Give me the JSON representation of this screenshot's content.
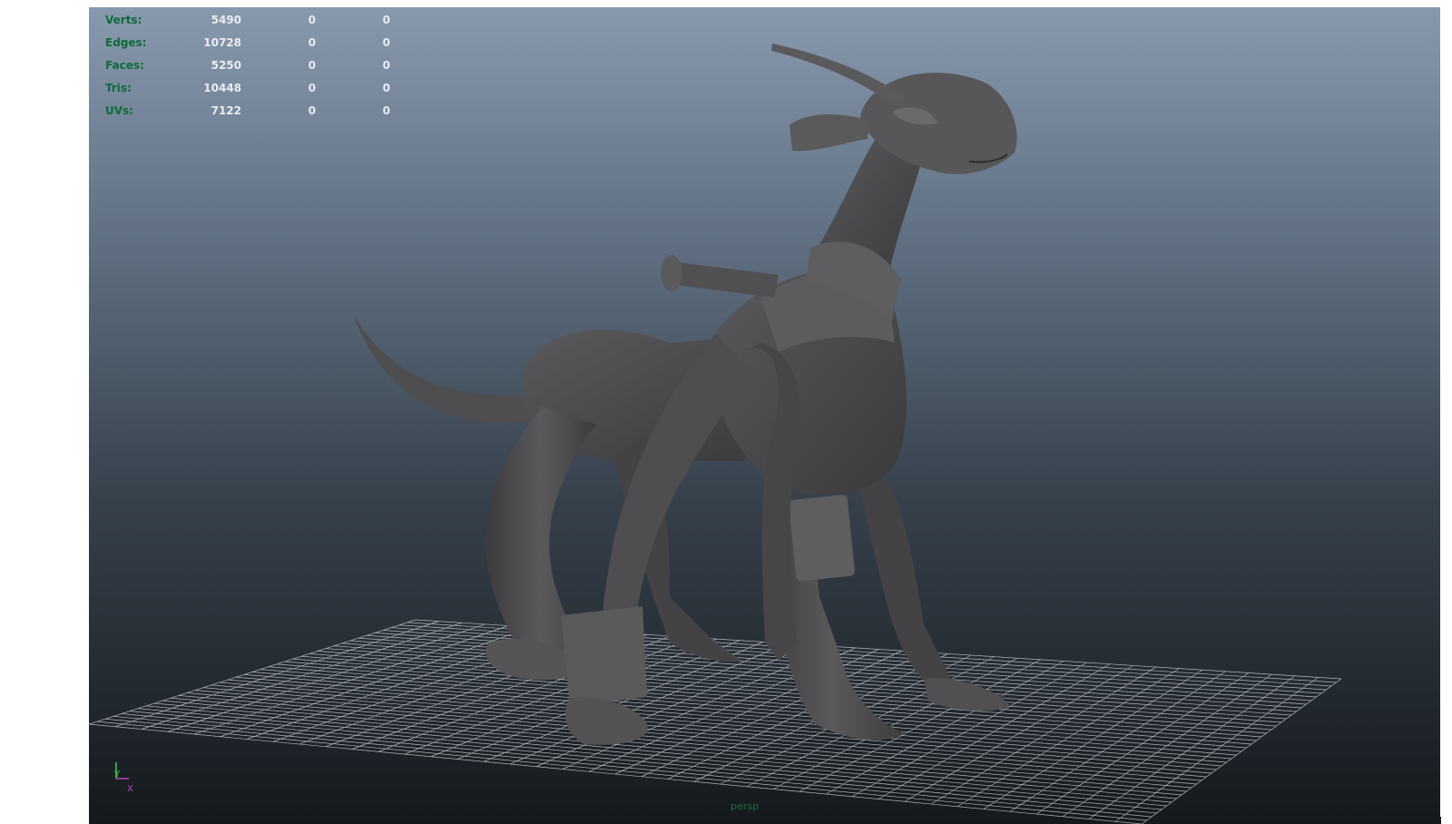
{
  "hud": {
    "rows": [
      {
        "label": "Verts:",
        "v1": "5490",
        "v2": "0",
        "v3": "0"
      },
      {
        "label": "Edges:",
        "v1": "10728",
        "v2": "0",
        "v3": "0"
      },
      {
        "label": "Faces:",
        "v1": "5250",
        "v2": "0",
        "v3": "0"
      },
      {
        "label": "Tris:",
        "v1": "10448",
        "v2": "0",
        "v3": "0"
      },
      {
        "label": "UVs:",
        "v1": "7122",
        "v2": "0",
        "v3": "0"
      }
    ]
  },
  "camera": {
    "label": "persp"
  },
  "axis": {
    "y": "Y",
    "x": "X"
  },
  "colors": {
    "hud_label": "#0e6b3a",
    "hud_value": "#e8ecf0",
    "grid_line": "#c8ccd0",
    "model": "#4a4a4c"
  }
}
